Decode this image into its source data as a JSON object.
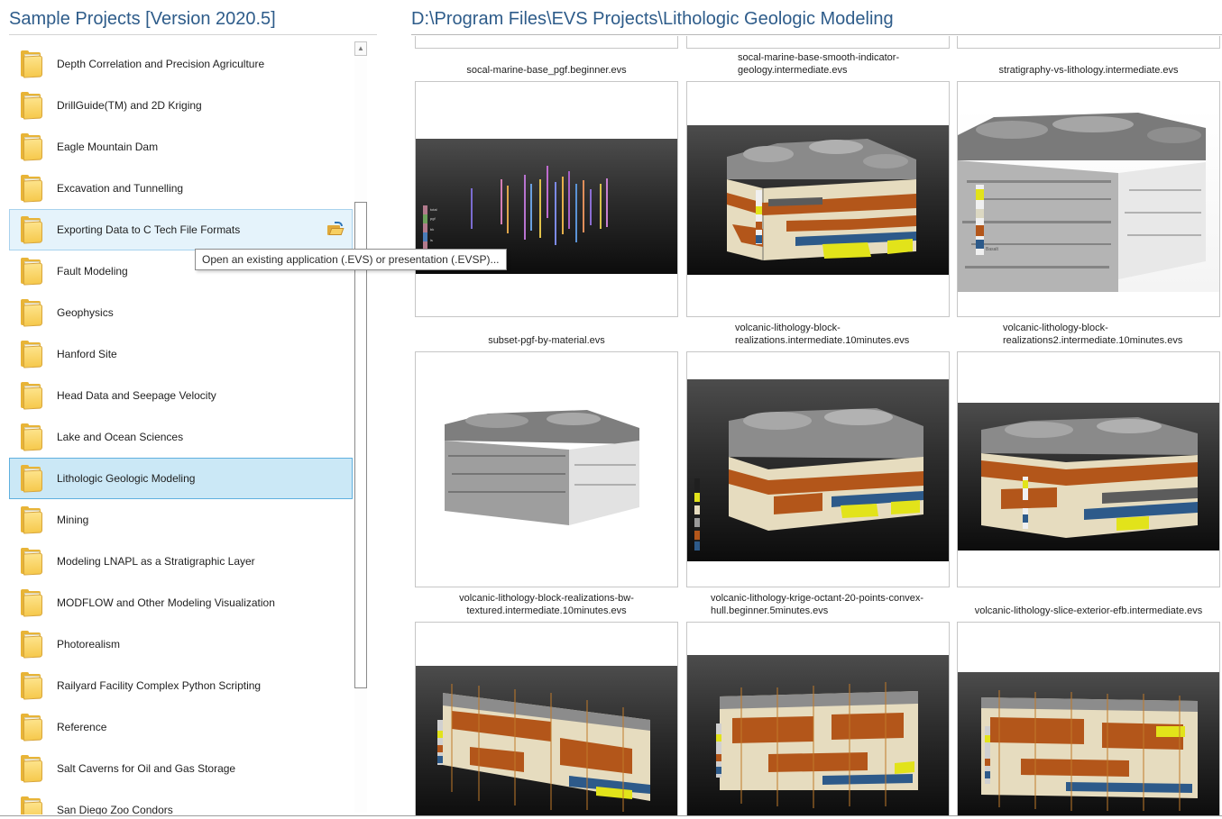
{
  "left_panel": {
    "title": "Sample Projects [Version 2020.5]",
    "items": [
      {
        "label": "Depth Correlation and Precision Agriculture"
      },
      {
        "label": "DrillGuide(TM) and 2D Kriging"
      },
      {
        "label": "Eagle Mountain Dam"
      },
      {
        "label": "Excavation and Tunnelling"
      },
      {
        "label": "Exporting Data to C Tech File Formats",
        "state": "hover"
      },
      {
        "label": "Fault Modeling"
      },
      {
        "label": "Geophysics"
      },
      {
        "label": "Hanford Site"
      },
      {
        "label": "Head Data and Seepage Velocity"
      },
      {
        "label": "Lake and Ocean Sciences"
      },
      {
        "label": "Lithologic Geologic Modeling",
        "state": "selected"
      },
      {
        "label": "Mining"
      },
      {
        "label": "Modeling LNAPL as a Stratigraphic Layer"
      },
      {
        "label": "MODFLOW and Other Modeling Visualization"
      },
      {
        "label": "Photorealism"
      },
      {
        "label": "Railyard Facility Complex Python Scripting"
      },
      {
        "label": "Reference"
      },
      {
        "label": "Salt Caverns for Oil and Gas Storage"
      },
      {
        "label": "San Diego Zoo Condors"
      }
    ],
    "tooltip": "Open an existing application (.EVS) or presentation (.EVSP)...",
    "scroll_up_glyph": "▲"
  },
  "right_panel": {
    "path": "D:\\Program Files\\EVS Projects\\Lithologic Geologic Modeling",
    "captions": {
      "r0c0": "socal-marine-base_pgf.beginner.evs",
      "r0c1_l1": "socal-marine-base-smooth-indicator-",
      "r0c1_l2": "geology.intermediate.evs",
      "r0c2": "stratigraphy-vs-lithology.intermediate.evs",
      "r1c0": "subset-pgf-by-material.evs",
      "r1c1_l1": "volcanic-lithology-block-",
      "r1c1_l2": "realizations.intermediate.10minutes.evs",
      "r1c2_l1": "volcanic-lithology-block-",
      "r1c2_l2": "realizations2.intermediate.10minutes.evs",
      "r2c0_l1": "volcanic-lithology-block-realizations-bw-",
      "r2c0_l2": "textured.intermediate.10minutes.evs",
      "r2c1_l1": "volcanic-lithology-krige-octant-20-points-convex-",
      "r2c1_l2": "hull.beginner.5minutes.evs",
      "r2c2": "volcanic-lithology-slice-exterior-efb.intermediate.evs"
    }
  },
  "colors": {
    "title_blue": "#2e5c8a",
    "hover_bg": "#e5f3fb",
    "selected_bg": "#cbe8f6",
    "selected_border": "#5fb0df",
    "geo_tan": "#e6dcbf",
    "geo_orange": "#b3561a",
    "geo_blue": "#2d5a8a",
    "geo_yellow": "#e2e31a",
    "geo_gray": "#9a9a9a"
  }
}
